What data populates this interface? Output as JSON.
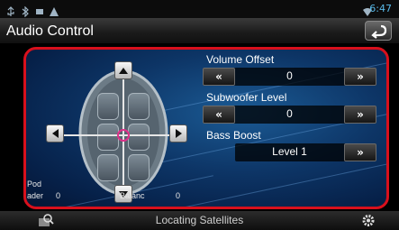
{
  "status_bar": {
    "icons": [
      "usb-icon",
      "bluetooth-icon",
      "message-icon",
      "warning-icon"
    ],
    "wifi_icon": "wifi-icon",
    "clock": "6:47"
  },
  "header": {
    "title": "Audio Control",
    "back_icon": "back-arrow-icon"
  },
  "position_control": {
    "icons": [
      "arrow-up-icon",
      "arrow-down-icon",
      "arrow-left-icon",
      "arrow-right-icon"
    ],
    "pod_label": "Pod",
    "fader_label": "ader",
    "fader_value": "0",
    "balance_label": "Balanc",
    "balance_value": "0"
  },
  "controls": {
    "volume_offset": {
      "label": "Volume Offset",
      "value": "0",
      "dec": "«",
      "inc": "»"
    },
    "subwoofer_level": {
      "label": "Subwoofer Level",
      "value": "0",
      "dec": "«",
      "inc": "»"
    },
    "bass_boost": {
      "label": "Bass Boost",
      "value": "Level 1",
      "inc": "»"
    }
  },
  "bottom_bar": {
    "status": "Locating Satellites",
    "left_icon": "map-search-icon",
    "right_icon": "gear-icon"
  },
  "colors": {
    "accent": "#d8101c",
    "clock": "#58b9e8",
    "target": "#e0308a",
    "panel_bg": "#0d3566"
  }
}
